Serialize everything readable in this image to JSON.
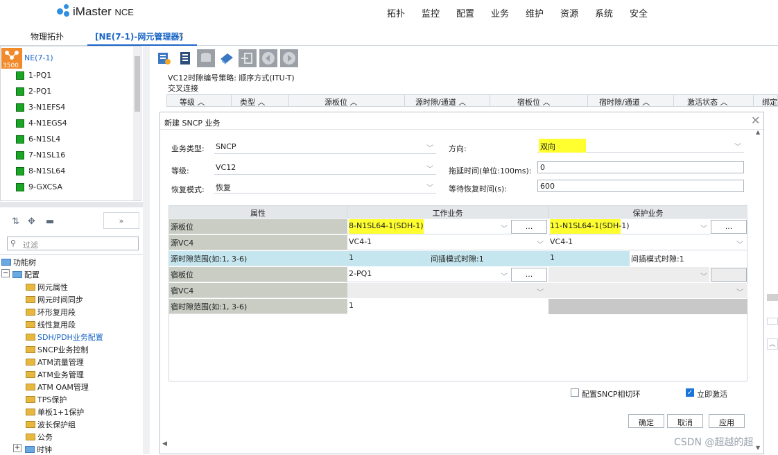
{
  "brand": {
    "name": "iMaster",
    "suffix": "NCE",
    "accent": "#2f8fe0"
  },
  "menu": [
    "拓扑",
    "监控",
    "配置",
    "业务",
    "维护",
    "资源",
    "系统",
    "安全"
  ],
  "tabs": {
    "topo": "物理拓扑",
    "ne": "[NE(7-1)-网元管理器]",
    "close": "×"
  },
  "ne_tree": {
    "root": "NE(7-1)",
    "root_icon_text": "3500",
    "boards": [
      "1-PQ1",
      "2-PQ1",
      "3-N1EFS4",
      "4-N1EGS4",
      "6-N1SL4",
      "7-N1SL16",
      "8-N1SL64",
      "9-GXCSA"
    ]
  },
  "left_tools": {
    "expand": "»"
  },
  "filter": {
    "placeholder": "过滤",
    "icon": "search-icon"
  },
  "func_tree": {
    "root": "功能树",
    "config": "配置",
    "items": [
      "网元属性",
      "网元时间同步",
      "环形复用段",
      "线性复用段",
      "SDH/PDH业务配置",
      "SNCP业务控制",
      "ATM流量管理",
      "ATM业务管理",
      "ATM OAM管理",
      "TPS保护",
      "单板1+1保护",
      "波长保护组",
      "公务"
    ],
    "clock": "时钟",
    "selected_color": "#1a66c7"
  },
  "strategy": "VC12时隙编号策略: 顺序方式(ITU-T)",
  "cross_label": "交叉连接",
  "cross_headers": [
    "等级",
    "类型",
    "源板位",
    "源时隙/通道",
    "宿板位",
    "宿时隙/通道",
    "激活状态",
    "绑定"
  ],
  "dialog": {
    "title": "新建 SNCP 业务",
    "fields": {
      "service_type_label": "业务类型:",
      "service_type": "SNCP",
      "direction_label": "方向:",
      "direction": "双向",
      "level_label": "等级:",
      "level": "VC12",
      "delay_label": "拖延时间(单位:100ms):",
      "delay": "0",
      "recovery_label": "恢复模式:",
      "recovery": "恢复",
      "wait_label": "等待恢复时间(s):",
      "wait": "600"
    },
    "grid": {
      "headers": [
        "属性",
        "工作业务",
        "保护业务"
      ],
      "rows": {
        "src_board": "源板位",
        "src_vc4": "源VC4",
        "src_slot": "源时隙范围(如:1, 3-6)",
        "dst_board": "宿板位",
        "dst_vc4": "宿VC4",
        "dst_slot": "宿时隙范围(如:1, 3-6)"
      },
      "work": {
        "src_board": "8-N1SL64-1(SDH-1)",
        "src_vc4": "VC4-1",
        "src_slot": "1",
        "interleave": "间插模式时隙:1",
        "dst_board": "2-PQ1",
        "dst_slot": "1"
      },
      "protect": {
        "src_board": "11-N1SL64-1(SDH-1)",
        "src_vc4": "VC4-1",
        "src_slot": "1",
        "interleave": "间插模式时隙:1"
      },
      "ellipsis": "..."
    },
    "options": {
      "loop": "配置SNCP相切环",
      "loop_checked": false,
      "activate": "立即激活",
      "activate_checked": true
    },
    "buttons": {
      "ok": "确定",
      "cancel": "取消",
      "apply": "应用"
    },
    "highlight": "#ffff30"
  },
  "watermark": "CSDN @超越的超"
}
